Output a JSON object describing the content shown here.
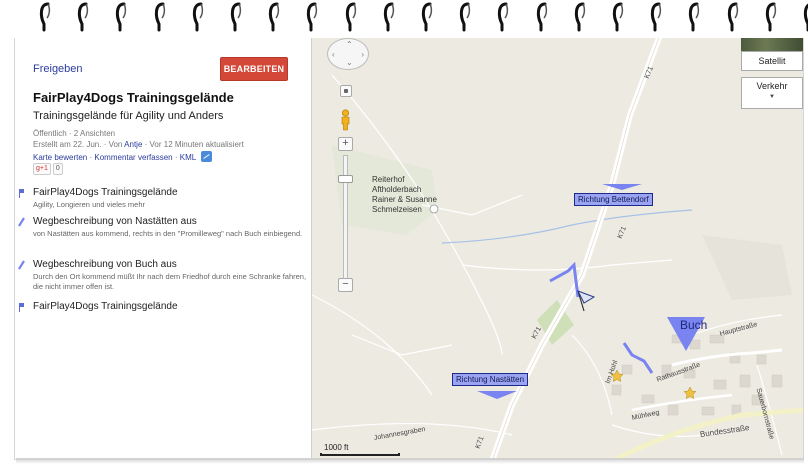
{
  "colors": {
    "accent_button": "#d44838",
    "link": "#2a3c9c",
    "route_line": "#7a84f0",
    "marker_fill": "#7a84f0",
    "road_yellow": "#f3f1c8"
  },
  "panel": {
    "share_label": "Freigeben",
    "edit_label": "BEARBEITEN",
    "title": "FairPlay4Dogs Trainingsgelände",
    "subtitle": "Trainingsgelände für Agility und Anders",
    "meta_line1": "Öffentlich · 2 Ansichten",
    "meta_line2_prefix": "Erstellt am 22. Jun. · Von",
    "meta_author": "Antje",
    "meta_line2_suffix": "· Vor 12 Minuten aktualisiert",
    "link_rate": "Karte bewerten",
    "link_comment": "Kommentar verfassen",
    "link_kml": "KML",
    "gplus_label": "g+1",
    "gplus_count": "0",
    "items": [
      {
        "title": "FairPlay4Dogs Trainingsgelände",
        "desc": "Agility, Longieren und vieles mehr",
        "icon": "blue-pin-icon"
      },
      {
        "title": "Wegbeschreibung von Nastätten aus",
        "desc": "von Nastätten aus kommend, rechts in den \"Promilleweg\" nach Buch einbiegend.",
        "icon": "route-line-icon"
      },
      {
        "title": "Wegbeschreibung von Buch aus",
        "desc": "Durch den Ort kommend müßt Ihr nach dem Friedhof durch eine Schranke fahren, die nicht immer offen ist.",
        "icon": "route-line-icon"
      },
      {
        "title": "FairPlay4Dogs Trainingsgelände",
        "desc": "",
        "icon": "blue-pin-icon"
      }
    ]
  },
  "map": {
    "maptype_satellite": "Satellit",
    "maptype_traffic": "Verkehr",
    "poi_label": "Reiterhof\nAftholderbach\nRainer & Susanne\nSchmelzeisen",
    "dir_bettendorf": "Richtung Bettendorf",
    "dir_nastaetten": "Richtung Nastätten",
    "buch_label": "Buch",
    "roads": {
      "k71_a": "K71",
      "k71_b": "K71",
      "k71_c": "K71",
      "k71_d": "K71",
      "hauptstrasse": "Hauptstraße",
      "rathausstrasse": "Rathausstraße",
      "muehlweg": "Mühlweg",
      "bundesstrasse": "Bundesstraße",
      "johannesgraben": "Johannesgraben",
      "sauerbornstrasse": "Sauerbornstraße",
      "im_hohl": "Im Hohl"
    },
    "scale_label": "1000 ft"
  }
}
